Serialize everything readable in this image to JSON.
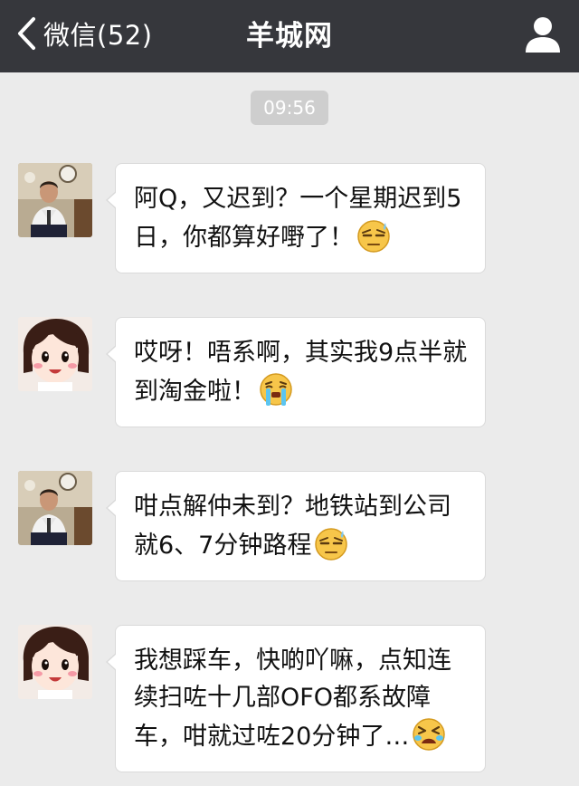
{
  "navbar": {
    "back_label": "微信(52)",
    "title": "羊城网"
  },
  "timestamp": "09:56",
  "messages": [
    {
      "sender": "man",
      "text": "阿Q，又迟到？一个星期迟到5日，你都算好嘢了！",
      "emoji": "sweat-face-icon"
    },
    {
      "sender": "girl",
      "text": "哎呀！唔系啊，其实我9点半就到淘金啦！",
      "emoji": "crying-face-icon"
    },
    {
      "sender": "man",
      "text": "咁点解仲未到？地铁站到公司就6、7分钟路程",
      "emoji": "sweat-face-icon"
    },
    {
      "sender": "girl",
      "text": "我想踩车，快啲吖嘛，点知连续扫咗十几部OFO都系故障车，咁就过咗20分钟了…",
      "emoji": "tired-face-icon"
    }
  ]
}
